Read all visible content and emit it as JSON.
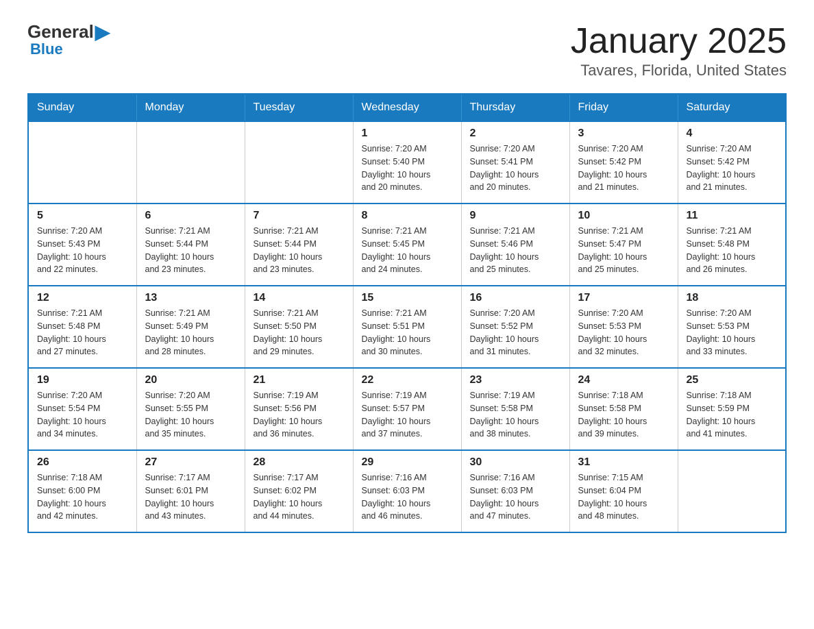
{
  "logo": {
    "general": "General",
    "blue": "Blue"
  },
  "header": {
    "title": "January 2025",
    "subtitle": "Tavares, Florida, United States"
  },
  "weekdays": [
    "Sunday",
    "Monday",
    "Tuesday",
    "Wednesday",
    "Thursday",
    "Friday",
    "Saturday"
  ],
  "weeks": [
    [
      {
        "day": "",
        "info": ""
      },
      {
        "day": "",
        "info": ""
      },
      {
        "day": "",
        "info": ""
      },
      {
        "day": "1",
        "info": "Sunrise: 7:20 AM\nSunset: 5:40 PM\nDaylight: 10 hours\nand 20 minutes."
      },
      {
        "day": "2",
        "info": "Sunrise: 7:20 AM\nSunset: 5:41 PM\nDaylight: 10 hours\nand 20 minutes."
      },
      {
        "day": "3",
        "info": "Sunrise: 7:20 AM\nSunset: 5:42 PM\nDaylight: 10 hours\nand 21 minutes."
      },
      {
        "day": "4",
        "info": "Sunrise: 7:20 AM\nSunset: 5:42 PM\nDaylight: 10 hours\nand 21 minutes."
      }
    ],
    [
      {
        "day": "5",
        "info": "Sunrise: 7:20 AM\nSunset: 5:43 PM\nDaylight: 10 hours\nand 22 minutes."
      },
      {
        "day": "6",
        "info": "Sunrise: 7:21 AM\nSunset: 5:44 PM\nDaylight: 10 hours\nand 23 minutes."
      },
      {
        "day": "7",
        "info": "Sunrise: 7:21 AM\nSunset: 5:44 PM\nDaylight: 10 hours\nand 23 minutes."
      },
      {
        "day": "8",
        "info": "Sunrise: 7:21 AM\nSunset: 5:45 PM\nDaylight: 10 hours\nand 24 minutes."
      },
      {
        "day": "9",
        "info": "Sunrise: 7:21 AM\nSunset: 5:46 PM\nDaylight: 10 hours\nand 25 minutes."
      },
      {
        "day": "10",
        "info": "Sunrise: 7:21 AM\nSunset: 5:47 PM\nDaylight: 10 hours\nand 25 minutes."
      },
      {
        "day": "11",
        "info": "Sunrise: 7:21 AM\nSunset: 5:48 PM\nDaylight: 10 hours\nand 26 minutes."
      }
    ],
    [
      {
        "day": "12",
        "info": "Sunrise: 7:21 AM\nSunset: 5:48 PM\nDaylight: 10 hours\nand 27 minutes."
      },
      {
        "day": "13",
        "info": "Sunrise: 7:21 AM\nSunset: 5:49 PM\nDaylight: 10 hours\nand 28 minutes."
      },
      {
        "day": "14",
        "info": "Sunrise: 7:21 AM\nSunset: 5:50 PM\nDaylight: 10 hours\nand 29 minutes."
      },
      {
        "day": "15",
        "info": "Sunrise: 7:21 AM\nSunset: 5:51 PM\nDaylight: 10 hours\nand 30 minutes."
      },
      {
        "day": "16",
        "info": "Sunrise: 7:20 AM\nSunset: 5:52 PM\nDaylight: 10 hours\nand 31 minutes."
      },
      {
        "day": "17",
        "info": "Sunrise: 7:20 AM\nSunset: 5:53 PM\nDaylight: 10 hours\nand 32 minutes."
      },
      {
        "day": "18",
        "info": "Sunrise: 7:20 AM\nSunset: 5:53 PM\nDaylight: 10 hours\nand 33 minutes."
      }
    ],
    [
      {
        "day": "19",
        "info": "Sunrise: 7:20 AM\nSunset: 5:54 PM\nDaylight: 10 hours\nand 34 minutes."
      },
      {
        "day": "20",
        "info": "Sunrise: 7:20 AM\nSunset: 5:55 PM\nDaylight: 10 hours\nand 35 minutes."
      },
      {
        "day": "21",
        "info": "Sunrise: 7:19 AM\nSunset: 5:56 PM\nDaylight: 10 hours\nand 36 minutes."
      },
      {
        "day": "22",
        "info": "Sunrise: 7:19 AM\nSunset: 5:57 PM\nDaylight: 10 hours\nand 37 minutes."
      },
      {
        "day": "23",
        "info": "Sunrise: 7:19 AM\nSunset: 5:58 PM\nDaylight: 10 hours\nand 38 minutes."
      },
      {
        "day": "24",
        "info": "Sunrise: 7:18 AM\nSunset: 5:58 PM\nDaylight: 10 hours\nand 39 minutes."
      },
      {
        "day": "25",
        "info": "Sunrise: 7:18 AM\nSunset: 5:59 PM\nDaylight: 10 hours\nand 41 minutes."
      }
    ],
    [
      {
        "day": "26",
        "info": "Sunrise: 7:18 AM\nSunset: 6:00 PM\nDaylight: 10 hours\nand 42 minutes."
      },
      {
        "day": "27",
        "info": "Sunrise: 7:17 AM\nSunset: 6:01 PM\nDaylight: 10 hours\nand 43 minutes."
      },
      {
        "day": "28",
        "info": "Sunrise: 7:17 AM\nSunset: 6:02 PM\nDaylight: 10 hours\nand 44 minutes."
      },
      {
        "day": "29",
        "info": "Sunrise: 7:16 AM\nSunset: 6:03 PM\nDaylight: 10 hours\nand 46 minutes."
      },
      {
        "day": "30",
        "info": "Sunrise: 7:16 AM\nSunset: 6:03 PM\nDaylight: 10 hours\nand 47 minutes."
      },
      {
        "day": "31",
        "info": "Sunrise: 7:15 AM\nSunset: 6:04 PM\nDaylight: 10 hours\nand 48 minutes."
      },
      {
        "day": "",
        "info": ""
      }
    ]
  ]
}
